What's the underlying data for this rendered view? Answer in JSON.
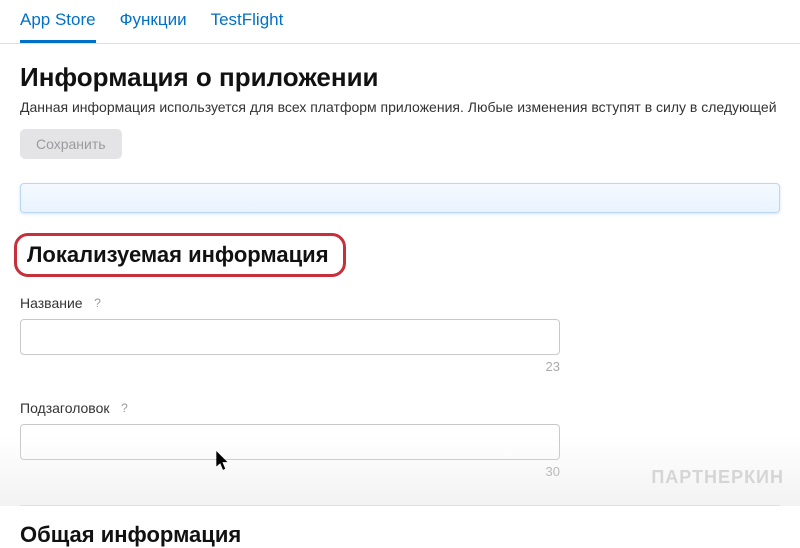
{
  "tabs": {
    "app_store": "App Store",
    "functions": "Функции",
    "testflight": "TestFlight"
  },
  "header": {
    "title": "Информация о приложении",
    "description": "Данная информация используется для всех платформ приложения. Любые изменения вступят в силу в следующей вер",
    "save_label": "Сохранить"
  },
  "localizable": {
    "section_title": "Локализуемая информация",
    "name": {
      "label": "Название",
      "value": "",
      "counter": "23"
    },
    "subtitle": {
      "label": "Подзаголовок",
      "value": "",
      "counter": "30"
    }
  },
  "general": {
    "section_title": "Общая информация"
  },
  "icons": {
    "help": "?"
  },
  "watermark": "ПАРТНЕРКИН"
}
